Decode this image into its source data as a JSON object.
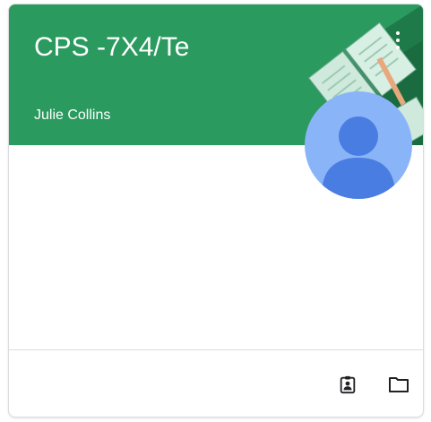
{
  "card": {
    "title": "CPS -7X4/Te",
    "teacher": "Julie Collins",
    "header_color": "#2a9a5f",
    "avatar_color": "#8ab4f8",
    "avatar_figure_color": "#4a7de2"
  },
  "icons": {
    "more": "more-vert-icon",
    "assignments": "assignment-ind-icon",
    "folder": "folder-icon"
  }
}
